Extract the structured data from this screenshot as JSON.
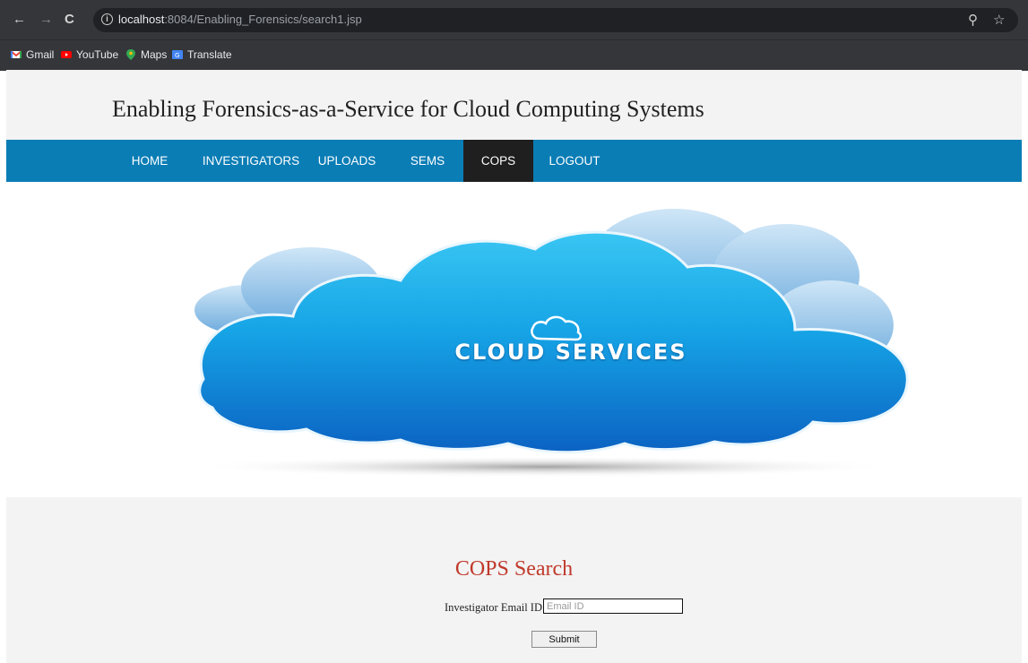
{
  "browser": {
    "url_host": "localhost",
    "url_path": ":8084/Enabling_Forensics/search1.jsp",
    "bookmarks": [
      {
        "label": "Gmail",
        "icon": "gmail-icon"
      },
      {
        "label": "YouTube",
        "icon": "youtube-icon"
      },
      {
        "label": "Maps",
        "icon": "maps-icon"
      },
      {
        "label": "Translate",
        "icon": "translate-icon"
      }
    ]
  },
  "site": {
    "title": "Enabling Forensics-as-a-Service for Cloud Computing Systems"
  },
  "nav": {
    "items": [
      "HOME",
      "INVESTIGATORS",
      "UPLOADS",
      "SEMS",
      "COPS",
      "LOGOUT"
    ],
    "active": "COPS"
  },
  "banner": {
    "text": "CLOUD SERVICES"
  },
  "search": {
    "title": "COPS Search",
    "email_label": "Investigator Email ID :",
    "email_placeholder": "Email ID",
    "email_value": "",
    "submit_label": "Submit"
  },
  "colors": {
    "nav_bg": "#0a7db5",
    "nav_active_bg": "#1f1f1f",
    "search_title": "#c0392b",
    "header_bg": "#f3f3f3"
  }
}
